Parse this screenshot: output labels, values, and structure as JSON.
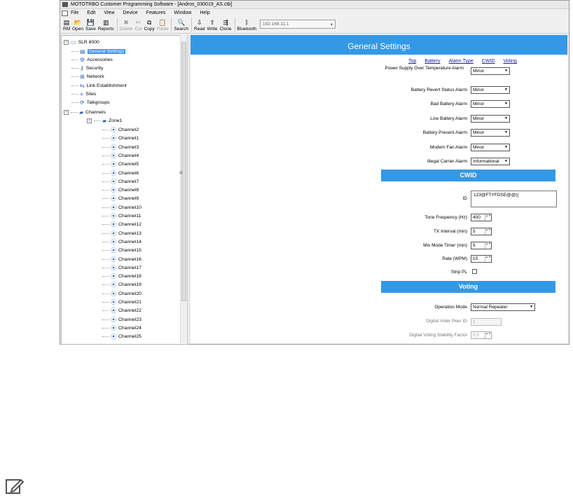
{
  "window": {
    "title": "MOTOTRBO Customer Programming Software - [Andros_030019_AS.ctb]"
  },
  "menu": [
    "File",
    "Edit",
    "View",
    "Device",
    "Features",
    "Window",
    "Help"
  ],
  "toolbar": [
    {
      "label": "RM",
      "icon": "rm-icon",
      "glyph": "▤",
      "enabled": true
    },
    {
      "label": "Open",
      "icon": "open-folder-icon",
      "glyph": "📂",
      "enabled": true
    },
    {
      "label": "Save",
      "icon": "save-icon",
      "glyph": "💾",
      "enabled": true
    },
    {
      "label": "Reports",
      "icon": "reports-icon",
      "glyph": "▥",
      "enabled": true
    },
    {
      "label": "Delete",
      "icon": "delete-icon",
      "glyph": "✖",
      "enabled": false
    },
    {
      "label": "Cut",
      "icon": "cut-icon",
      "glyph": "✂",
      "enabled": false
    },
    {
      "label": "Copy",
      "icon": "copy-icon",
      "glyph": "⧉",
      "enabled": true
    },
    {
      "label": "Paste",
      "icon": "paste-icon",
      "glyph": "📋",
      "enabled": false
    },
    {
      "label": "Search",
      "icon": "search-icon",
      "glyph": "🔍",
      "enabled": true
    },
    {
      "label": "Read",
      "icon": "read-icon",
      "glyph": "⇩",
      "enabled": true
    },
    {
      "label": "Write",
      "icon": "write-icon",
      "glyph": "⇧",
      "enabled": true
    },
    {
      "label": "Clone",
      "icon": "clone-icon",
      "glyph": "⇶",
      "enabled": true
    },
    {
      "label": "Bluetooth",
      "icon": "bluetooth-icon",
      "glyph": "ᛒ",
      "enabled": true
    }
  ],
  "ip_address": "192.168.11.1",
  "tree": {
    "root": "SLR 8000",
    "items": [
      "General Settings",
      "Accessories",
      "Security",
      "Network",
      "Link Establishment",
      "Sites",
      "Talkgroups"
    ],
    "channels_label": "Channels",
    "zone_label": "Zone1",
    "channels": [
      "Channel2",
      "Channel1",
      "Channel3",
      "Channel4",
      "Channel5",
      "Channel6",
      "Channel7",
      "Channel8",
      "Channel9",
      "Channel10",
      "Channel11",
      "Channel12",
      "Channel13",
      "Channel14",
      "Channel15",
      "Channel16",
      "Channel17",
      "Channel18",
      "Channel19",
      "Channel20",
      "Channel21",
      "Channel22",
      "Channel23",
      "Channel24",
      "Channel25"
    ]
  },
  "main": {
    "header": "General Settings",
    "nav": [
      "Top",
      "Battery",
      "Alarm Type",
      "CWID",
      "Voting"
    ],
    "alarms": [
      {
        "label": "Power Supply Over Temperature Alarm",
        "value": "Minor"
      },
      {
        "label": "Battery Revert Status Alarm",
        "value": "Minor"
      },
      {
        "label": "Bad Battery Alarm",
        "value": "Minor"
      },
      {
        "label": "Low Battery Alarm",
        "value": "Minor"
      },
      {
        "label": "Battery Present Alarm",
        "value": "Minor"
      },
      {
        "label": "Modem Fan Alarm",
        "value": "Minor"
      },
      {
        "label": "Illegal Carrier Alarm",
        "value": "Informational"
      }
    ],
    "cwid": {
      "title": "CWID",
      "id_label": "ID",
      "id_value": "123@FTYFDSE@@((",
      "tone_label": "Tone Frequency (Hz)",
      "tone_value": "400",
      "tx_label": "TX Interval (min)",
      "tx_value": "5",
      "mix_label": "Mix Mode Timer (min)",
      "mix_value": "5",
      "rate_label": "Rate (WPM)",
      "rate_value": "15",
      "strip_label": "Strip PL"
    },
    "voting": {
      "title": "Voting",
      "op_label": "Operation Mode",
      "op_value": "Normal Repeater",
      "peer_label": "Digital Voter Peer ID",
      "peer_value": "1",
      "stab_label": "Digital Voting Stability Factor",
      "stab_value": "0.5"
    }
  },
  "colors": {
    "header": "#3399e6",
    "selection": "#3399ff"
  }
}
